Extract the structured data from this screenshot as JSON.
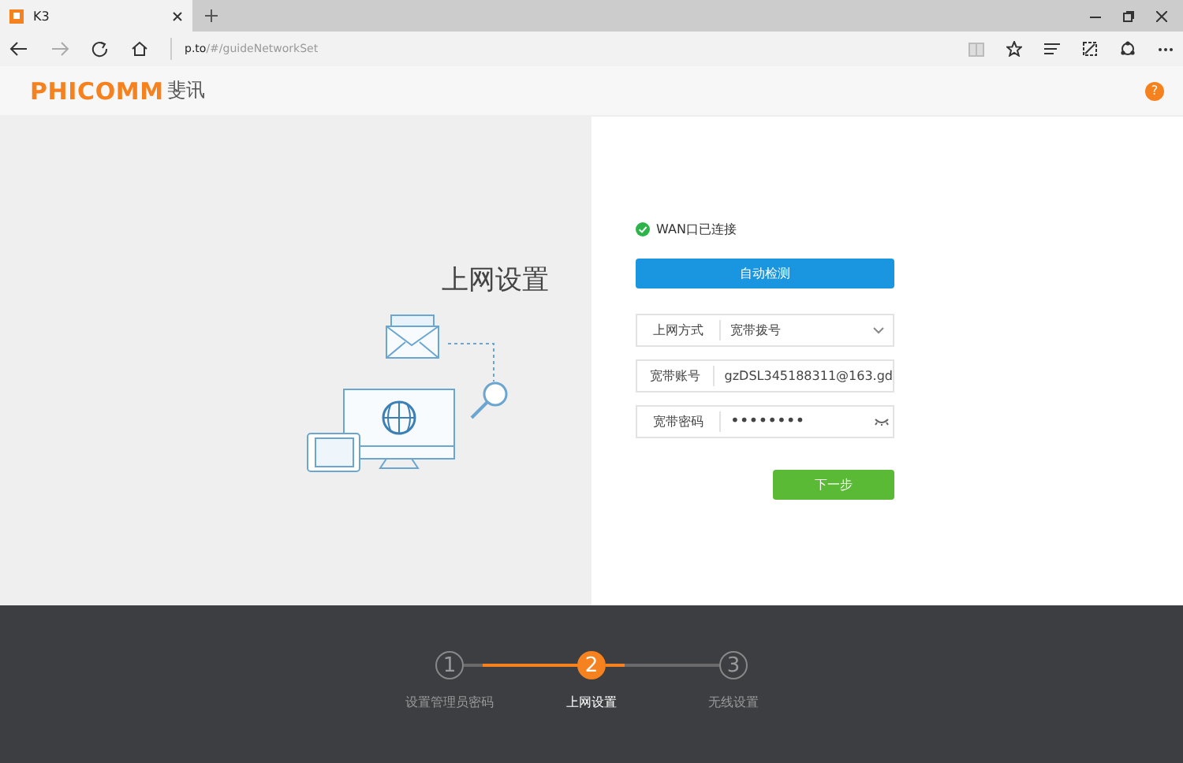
{
  "browser": {
    "tab_title": "K3",
    "url_host": "p.to",
    "url_path": "/#/guideNetworkSet"
  },
  "header": {
    "brand": "PHICOMM",
    "brand_cn": "斐讯",
    "help": "?"
  },
  "page": {
    "title": "上网设置"
  },
  "form": {
    "status": "WAN口已连接",
    "connected": true,
    "detect_button": "自动检测",
    "fields": [
      {
        "kind": "select",
        "label": "上网方式",
        "value": "宽带拨号"
      },
      {
        "kind": "text",
        "label": "宽带账号",
        "value": "gzDSL345188311@163.gd"
      },
      {
        "kind": "password",
        "label": "宽带密码",
        "value": "••••••••"
      }
    ],
    "next_button": "下一步"
  },
  "steps": [
    {
      "number": "1",
      "label": "设置管理员密码",
      "selected": false
    },
    {
      "number": "2",
      "label": "上网设置",
      "selected": true
    },
    {
      "number": "3",
      "label": "无线设置",
      "selected": false
    }
  ]
}
